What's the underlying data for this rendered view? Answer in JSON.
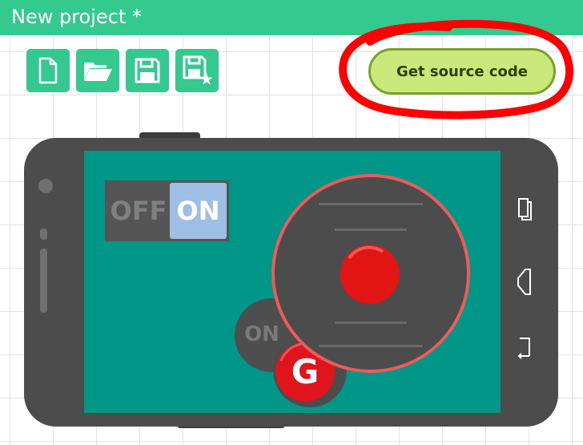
{
  "app": {
    "project_title": "New project *"
  },
  "toolbar": {
    "buttons": [
      {
        "name": "new-project-button",
        "icon": "new-file-icon"
      },
      {
        "name": "open-project-button",
        "icon": "open-folder-icon"
      },
      {
        "name": "save-project-button",
        "icon": "save-icon"
      },
      {
        "name": "save-as-button",
        "icon": "save-as-icon"
      }
    ],
    "source_button_label": "Get source code"
  },
  "canvas": {
    "toggle": {
      "off_label": "OFF",
      "on_label": "ON"
    },
    "round_button_label": "ON",
    "gamepad_badge_label": "G"
  },
  "colors": {
    "accent": "#34c98e",
    "source_button": "#cbe87a",
    "phone_body": "#4c4c4c",
    "phone_screen": "#009688",
    "joystick_knob": "#e31414",
    "annotation": "#ff0000"
  }
}
